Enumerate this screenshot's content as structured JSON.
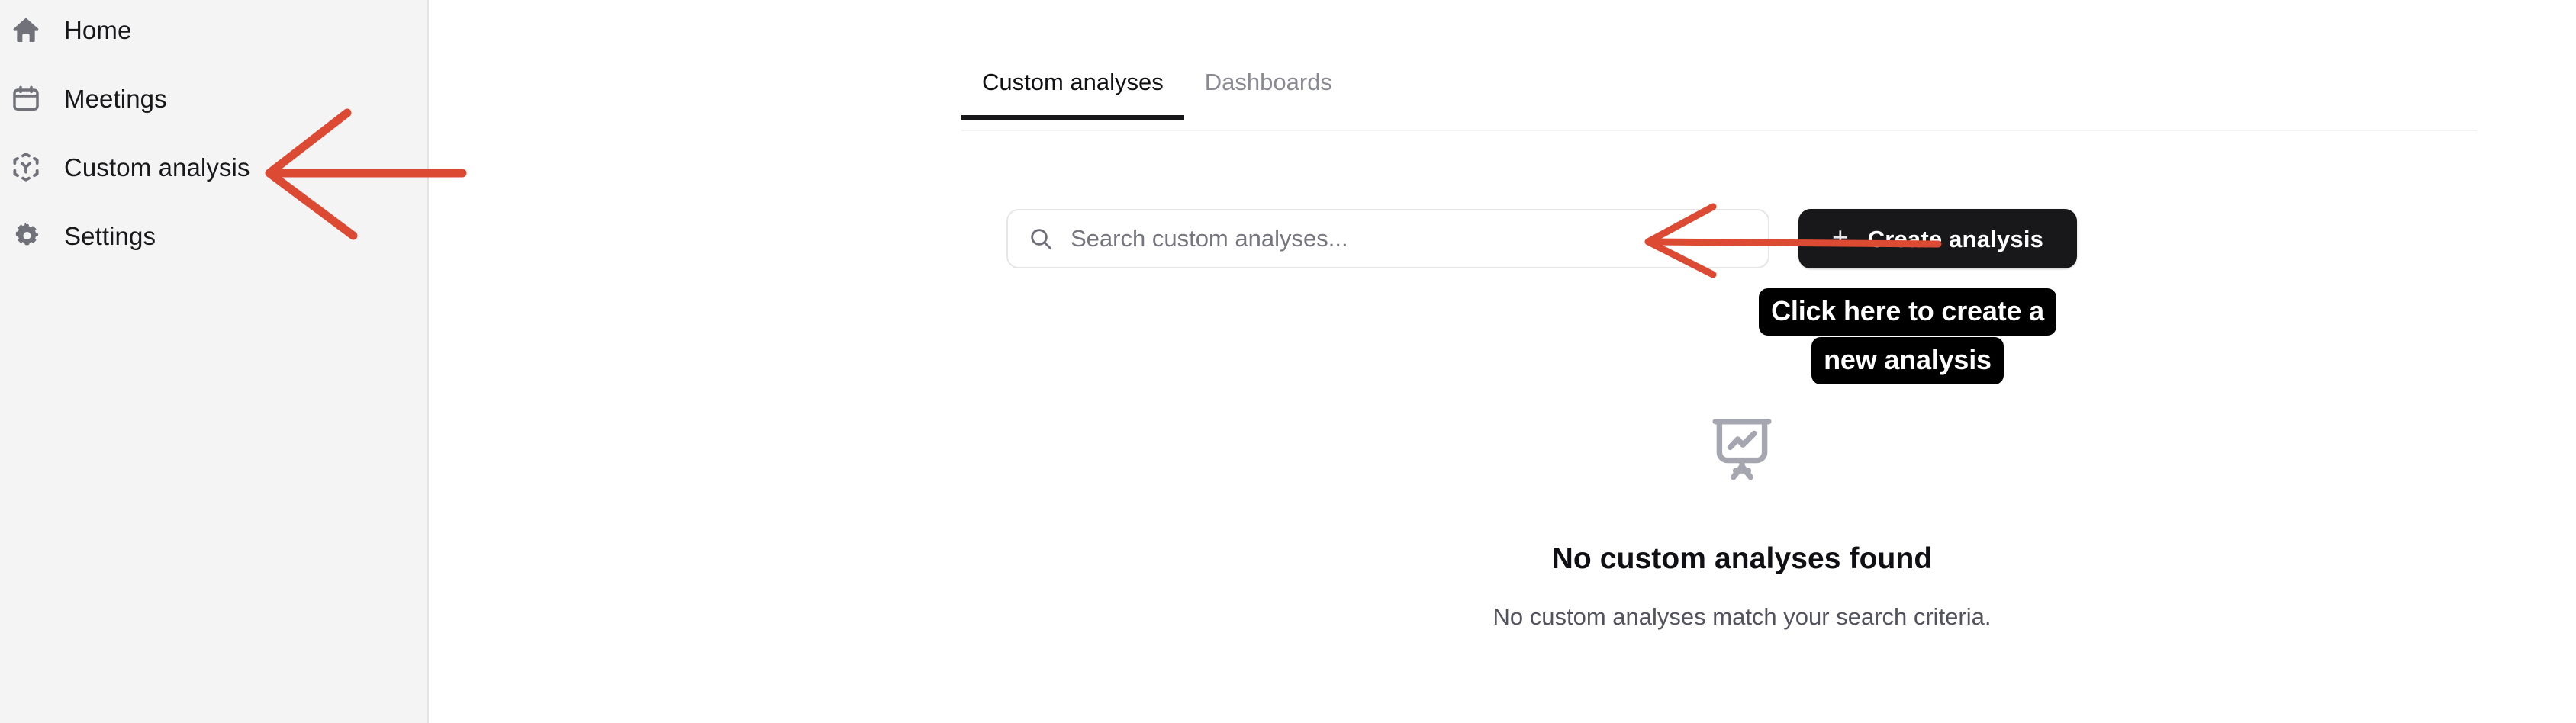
{
  "sidebar": {
    "items": [
      {
        "label": "Home",
        "icon": "home-icon",
        "active": false
      },
      {
        "label": "Meetings",
        "icon": "calendar-icon",
        "active": false
      },
      {
        "label": "Custom analysis",
        "icon": "custom-analysis-icon",
        "active": false
      },
      {
        "label": "Settings",
        "icon": "gear-icon",
        "active": false
      }
    ]
  },
  "tabs": [
    {
      "label": "Custom analyses",
      "active": true
    },
    {
      "label": "Dashboards",
      "active": false
    }
  ],
  "search": {
    "value": "",
    "placeholder": "Search custom analyses...",
    "icon": "search-icon"
  },
  "toolbar": {
    "create_plus": "+",
    "create_label": "Create analysis"
  },
  "empty_state": {
    "icon": "presentation-chart-icon",
    "title": "No custom analyses found",
    "subtitle": "No custom analyses match your search criteria."
  },
  "annotations": {
    "callout_line_1": "Click here to create a",
    "callout_line_2": "new analysis",
    "arrow_color": "#dd4a33",
    "callout_bg": "#000000",
    "callout_fg": "#ffffff"
  },
  "colors": {
    "sidebar_bg": "#f4f4f5",
    "main_bg": "#ffffff",
    "accent_dark": "#18181b",
    "muted_text": "#53535e",
    "annotation_red": "#dd4a33"
  }
}
